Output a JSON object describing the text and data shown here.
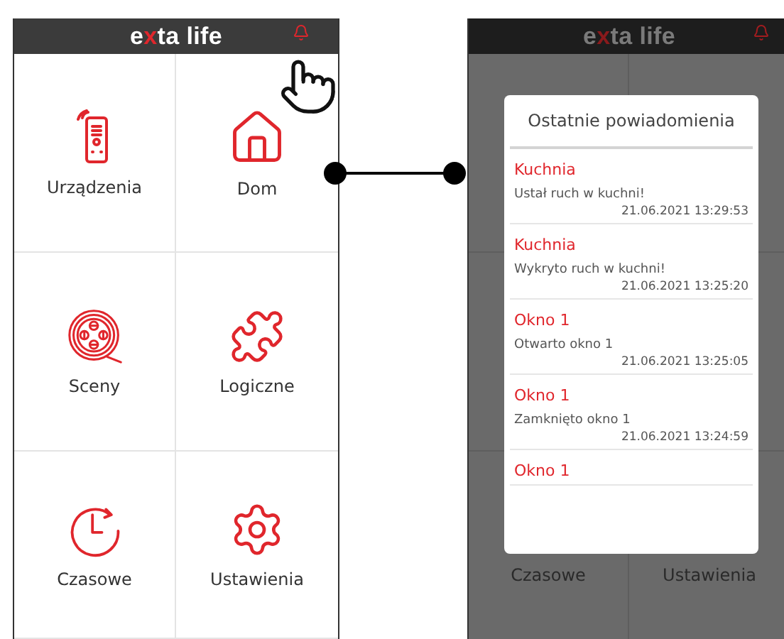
{
  "left_screen": {
    "logo": [
      {
        "text": "e",
        "accent": false
      },
      {
        "text": "x",
        "accent": true
      },
      {
        "text": "ta life",
        "accent": false
      }
    ],
    "tiles": [
      {
        "kind": "devices",
        "label": "Urządzenia"
      },
      {
        "kind": "home",
        "label": "Dom"
      },
      {
        "kind": "scenes",
        "label": "Sceny"
      },
      {
        "kind": "logic",
        "label": "Logiczne"
      },
      {
        "kind": "timers",
        "label": "Czasowe"
      },
      {
        "kind": "settings",
        "label": "Ustawienia"
      }
    ]
  },
  "right_screen": {
    "logo": [
      {
        "text": "e",
        "accent": false
      },
      {
        "text": "x",
        "accent": true
      },
      {
        "text": "ta life",
        "accent": false
      }
    ],
    "background_tiles": [
      {
        "label": "Czasowe"
      },
      {
        "label": "Ustawienia"
      }
    ],
    "notifications_popup": {
      "title": "Ostatnie powiadomienia",
      "items": [
        {
          "title": "Kuchnia",
          "message": "Ustał ruch w kuchni!",
          "time": "21.06.2021 13:29:53"
        },
        {
          "title": "Kuchnia",
          "message": "Wykryto ruch w kuchni!",
          "time": "21.06.2021 13:25:20"
        },
        {
          "title": "Okno 1",
          "message": "Otwarto okno 1",
          "time": "21.06.2021 13:25:05"
        },
        {
          "title": "Okno 1",
          "message": "Zamknięto okno 1",
          "time": "21.06.2021 13:24:59"
        },
        {
          "title": "Okno 1"
        }
      ]
    }
  }
}
